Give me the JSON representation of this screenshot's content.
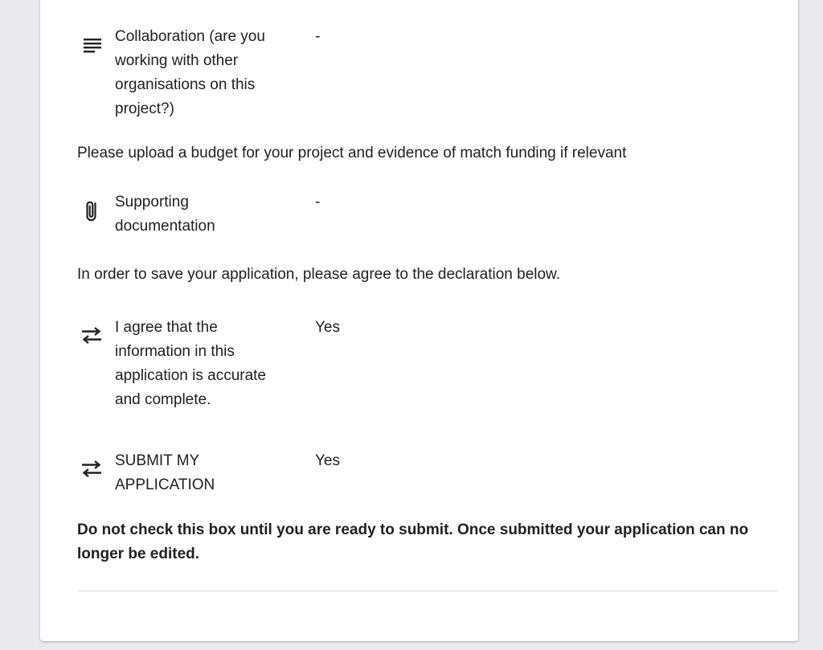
{
  "fields": [
    {
      "icon": "notes-icon",
      "label": "Collaboration (are you working with other organisations on this project?)",
      "value": "-"
    },
    {
      "icon": "paperclip-icon",
      "label": "Supporting documentation",
      "value": "-"
    },
    {
      "icon": "swap-arrows-icon",
      "label": "I agree that the information in this application is accurate and complete.",
      "value": "Yes"
    },
    {
      "icon": "swap-arrows-icon",
      "label": "SUBMIT MY APPLICATION",
      "value": "Yes"
    }
  ],
  "paragraphs": {
    "budget_note": "Please upload a budget for your project and evidence of match funding if relevant",
    "declaration_note": "In order to save your application, please agree to the declaration below.",
    "submit_warning": "Do not check this box until you are ready to submit. Once submitted your application can no longer be edited."
  }
}
